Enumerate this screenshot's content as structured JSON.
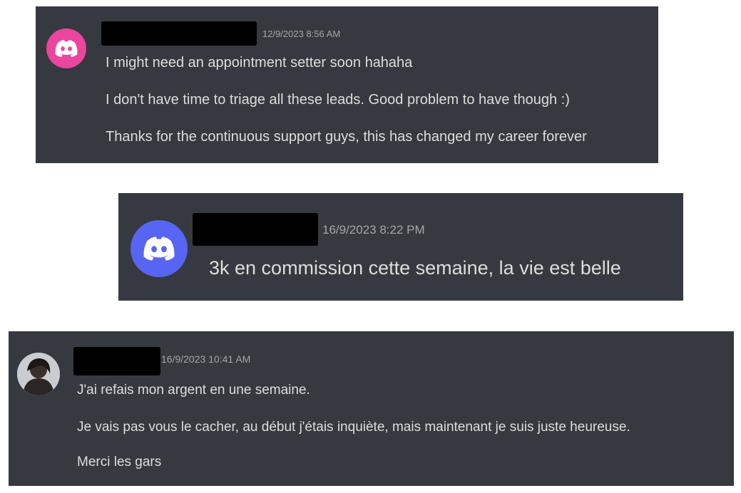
{
  "colors": {
    "card_background": "#36393f",
    "message_text": "#dcddde",
    "timestamp_text": "#a3a6aa",
    "avatar_pink": "#eb459e",
    "avatar_blurple": "#5865f2",
    "redaction": "#000000"
  },
  "messages": [
    {
      "avatar_icon": "discord-logo-icon",
      "author": "",
      "timestamp": "12/9/2023 8:56 AM",
      "lines": [
        "I might need an appointment setter soon hahaha",
        "I don't have time to triage all these leads. Good problem to have though :)",
        "Thanks for the continuous support guys, this has changed my career forever"
      ]
    },
    {
      "avatar_icon": "discord-logo-icon",
      "author": "",
      "timestamp": "16/9/2023 8:22 PM",
      "lines": [
        "3k en commission cette semaine, la vie est belle"
      ]
    },
    {
      "avatar_icon": "user-photo-avatar",
      "author": "",
      "timestamp": "16/9/2023 10:41 AM",
      "lines": [
        "J'ai refais mon argent en une semaine.",
        "Je vais pas vous le cacher, au début j'étais inquiète, mais maintenant je suis juste heureuse.",
        "Merci les gars"
      ]
    }
  ]
}
